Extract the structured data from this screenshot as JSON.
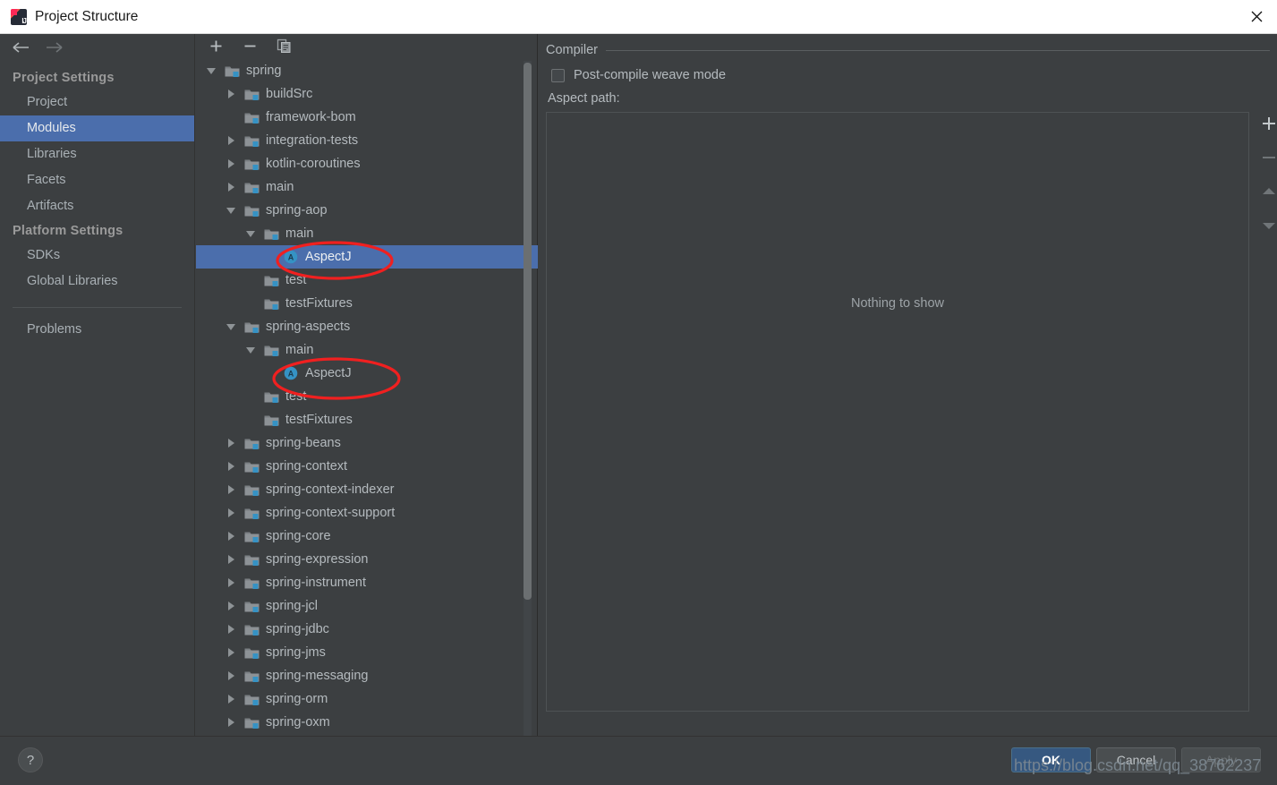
{
  "window": {
    "title": "Project Structure",
    "app_icon": "intellij-idea-icon",
    "close_icon": "close-icon"
  },
  "sidebar": {
    "back_icon": "arrow-left-icon",
    "forward_icon": "arrow-right-icon",
    "groups": [
      {
        "title": "Project Settings",
        "items": [
          {
            "label": "Project",
            "selected": false
          },
          {
            "label": "Modules",
            "selected": true
          },
          {
            "label": "Libraries",
            "selected": false
          },
          {
            "label": "Facets",
            "selected": false
          },
          {
            "label": "Artifacts",
            "selected": false
          }
        ]
      },
      {
        "title": "Platform Settings",
        "items": [
          {
            "label": "SDKs",
            "selected": false
          },
          {
            "label": "Global Libraries",
            "selected": false
          }
        ]
      }
    ],
    "extra_items": [
      {
        "label": "Problems",
        "selected": false
      }
    ]
  },
  "tree_toolbar": {
    "add_label": "+",
    "remove_label": "−",
    "copy_icon": "copy-icon",
    "add_icon": "plus-icon",
    "remove_icon": "minus-icon"
  },
  "tree": {
    "rows": [
      {
        "label": "spring",
        "indent": 0,
        "twisty": "expanded",
        "icon": "module-folder-icon",
        "selected": false
      },
      {
        "label": "buildSrc",
        "indent": 1,
        "twisty": "collapsed",
        "icon": "module-folder-icon",
        "selected": false
      },
      {
        "label": "framework-bom",
        "indent": 1,
        "twisty": "none",
        "icon": "module-folder-icon",
        "selected": false
      },
      {
        "label": "integration-tests",
        "indent": 1,
        "twisty": "collapsed",
        "icon": "module-folder-icon",
        "selected": false
      },
      {
        "label": "kotlin-coroutines",
        "indent": 1,
        "twisty": "collapsed",
        "icon": "module-folder-icon",
        "selected": false
      },
      {
        "label": "main",
        "indent": 1,
        "twisty": "collapsed",
        "icon": "module-folder-icon",
        "selected": false
      },
      {
        "label": "spring-aop",
        "indent": 1,
        "twisty": "expanded",
        "icon": "module-folder-icon",
        "selected": false
      },
      {
        "label": "main",
        "indent": 2,
        "twisty": "expanded",
        "icon": "module-folder-icon",
        "selected": false
      },
      {
        "label": "AspectJ",
        "indent": 3,
        "twisty": "none",
        "icon": "aspectj-icon",
        "selected": true
      },
      {
        "label": "test",
        "indent": 2,
        "twisty": "none",
        "icon": "module-folder-icon",
        "selected": false
      },
      {
        "label": "testFixtures",
        "indent": 2,
        "twisty": "none",
        "icon": "module-folder-icon",
        "selected": false
      },
      {
        "label": "spring-aspects",
        "indent": 1,
        "twisty": "expanded",
        "icon": "module-folder-icon",
        "selected": false
      },
      {
        "label": "main",
        "indent": 2,
        "twisty": "expanded",
        "icon": "module-folder-icon",
        "selected": false
      },
      {
        "label": "AspectJ",
        "indent": 3,
        "twisty": "none",
        "icon": "aspectj-icon",
        "selected": false
      },
      {
        "label": "test",
        "indent": 2,
        "twisty": "none",
        "icon": "module-folder-icon",
        "selected": false
      },
      {
        "label": "testFixtures",
        "indent": 2,
        "twisty": "none",
        "icon": "module-folder-icon",
        "selected": false
      },
      {
        "label": "spring-beans",
        "indent": 1,
        "twisty": "collapsed",
        "icon": "module-folder-icon",
        "selected": false
      },
      {
        "label": "spring-context",
        "indent": 1,
        "twisty": "collapsed",
        "icon": "module-folder-icon",
        "selected": false
      },
      {
        "label": "spring-context-indexer",
        "indent": 1,
        "twisty": "collapsed",
        "icon": "module-folder-icon",
        "selected": false
      },
      {
        "label": "spring-context-support",
        "indent": 1,
        "twisty": "collapsed",
        "icon": "module-folder-icon",
        "selected": false
      },
      {
        "label": "spring-core",
        "indent": 1,
        "twisty": "collapsed",
        "icon": "module-folder-icon",
        "selected": false
      },
      {
        "label": "spring-expression",
        "indent": 1,
        "twisty": "collapsed",
        "icon": "module-folder-icon",
        "selected": false
      },
      {
        "label": "spring-instrument",
        "indent": 1,
        "twisty": "collapsed",
        "icon": "module-folder-icon",
        "selected": false
      },
      {
        "label": "spring-jcl",
        "indent": 1,
        "twisty": "collapsed",
        "icon": "module-folder-icon",
        "selected": false
      },
      {
        "label": "spring-jdbc",
        "indent": 1,
        "twisty": "collapsed",
        "icon": "module-folder-icon",
        "selected": false
      },
      {
        "label": "spring-jms",
        "indent": 1,
        "twisty": "collapsed",
        "icon": "module-folder-icon",
        "selected": false
      },
      {
        "label": "spring-messaging",
        "indent": 1,
        "twisty": "collapsed",
        "icon": "module-folder-icon",
        "selected": false
      },
      {
        "label": "spring-orm",
        "indent": 1,
        "twisty": "collapsed",
        "icon": "module-folder-icon",
        "selected": false
      },
      {
        "label": "spring-oxm",
        "indent": 1,
        "twisty": "collapsed",
        "icon": "module-folder-icon",
        "selected": false
      }
    ]
  },
  "content": {
    "section_title": "Compiler",
    "checkbox_label": "Post-compile weave mode",
    "checkbox_checked": false,
    "aspect_path_label": "Aspect path:",
    "empty_text": "Nothing to show",
    "side_buttons": [
      {
        "name": "add-aspect-path-button",
        "icon": "plus-icon",
        "enabled": true
      },
      {
        "name": "remove-aspect-path-button",
        "icon": "minus-icon",
        "enabled": false
      },
      {
        "name": "move-up-aspect-path-button",
        "icon": "arrow-up-icon",
        "enabled": false
      },
      {
        "name": "move-down-aspect-path-button",
        "icon": "arrow-down-icon",
        "enabled": false
      }
    ]
  },
  "footer": {
    "help_label": "?",
    "ok_label": "OK",
    "cancel_label": "Cancel",
    "apply_label": "Apply"
  },
  "overlay": {
    "watermark": "https://blog.csdn.net/qq_38762237",
    "annotation_color": "#F02020",
    "annotations": [
      {
        "name": "annotation-ellipse-aspectj-aop",
        "target": "AspectJ (spring-aop)"
      },
      {
        "name": "annotation-ellipse-aspectj-aspects",
        "target": "AspectJ (spring-aspects)"
      }
    ]
  },
  "colors": {
    "window_bg": "#3C3F41",
    "title_bg": "#FFFFFF",
    "selection_blue": "#4B6EAC",
    "text": "#B4BABE",
    "primary_button": "#365880",
    "annotation_red": "#F02020"
  }
}
